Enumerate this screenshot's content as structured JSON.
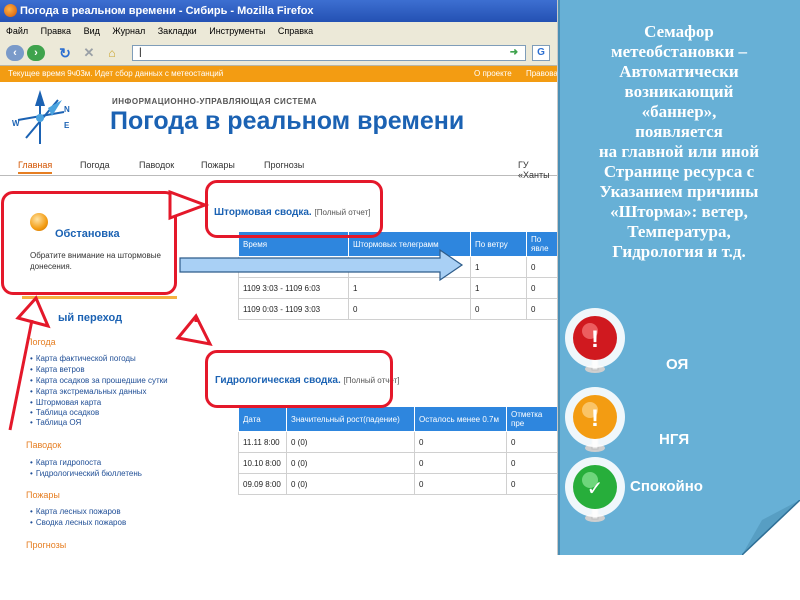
{
  "browser": {
    "window_title": "Погода в реальном времени - Сибирь - Mozilla Firefox",
    "menu": [
      {
        "label": "Файл"
      },
      {
        "label": "Правка"
      },
      {
        "label": "Вид"
      },
      {
        "label": "Журнал"
      },
      {
        "label": "Закладки"
      },
      {
        "label": "Инструменты"
      },
      {
        "label": "Справка"
      }
    ],
    "url_value": "|"
  },
  "site": {
    "status_text": "Текущее время 9ч03м. Идет сбор данных с метеостанций",
    "top_links": [
      "О проекте",
      "Правовая"
    ],
    "logo_subtitle": "ИНФОРМАЦИОННО-УПРАВЛЯЮЩАЯ СИСТЕМА",
    "logo_title": "Погода в реальном времени",
    "tabs": [
      "Главная",
      "Погода",
      "Паводок",
      "Пожары",
      "Прогнозы"
    ],
    "org": "ГУ «Ханты",
    "notice": {
      "title": "Обстановка",
      "text": "Обратите внимание на штормовые донесения."
    },
    "quick": {
      "title": "ый переход",
      "groups": [
        {
          "heading": "Погода",
          "links": [
            "Карта фактической погоды",
            "Карта ветров",
            "Карта осадков за прошедшие сутки",
            "Карта экстремальных данных",
            "Штормовая карта",
            "Таблица осадков",
            "Таблица ОЯ"
          ]
        },
        {
          "heading": "Паводок",
          "links": [
            "Карта гидропоста",
            "Гидрологический бюллетень"
          ]
        },
        {
          "heading": "Пожары",
          "links": [
            "Карта лесных пожаров",
            "Сводка лесных пожаров"
          ]
        },
        {
          "heading": "Прогнозы",
          "links": []
        }
      ]
    },
    "storm": {
      "title": "Штормовая сводка.",
      "full_report": "[Полный отчет]",
      "headers": [
        "Время",
        "Штормовых телеграмм",
        "По ветру",
        "По явле"
      ],
      "rows": [
        [
          "",
          "",
          "1",
          "0"
        ],
        [
          "1109 3:03 - 1109 6:03",
          "1",
          "1",
          "0"
        ],
        [
          "1109 0:03 - 1109 3:03",
          "0",
          "0",
          "0"
        ]
      ]
    },
    "hydro": {
      "title": "Гидрологическая сводка.",
      "full_report": "[Полный отчет]",
      "headers": [
        "Дата",
        "Значительный рост(падение)",
        "Осталось менее 0.7м",
        "Отметка пре"
      ],
      "rows": [
        [
          "11.11 8:00",
          "0 (0)",
          "0",
          "0"
        ],
        [
          "10.10 8:00",
          "0 (0)",
          "0",
          "0"
        ],
        [
          "09.09 8:00",
          "0 (0)",
          "0",
          "0"
        ]
      ]
    }
  },
  "panel": {
    "lines": [
      "Семафор",
      "метеобстановки –",
      "Автоматически",
      "возникающий",
      "«баннер»,",
      "появляется",
      "на главной или иной",
      "Странице ресурса с",
      "Указанием причины",
      "«Шторма»: ветер,",
      "Температура,",
      "Гидрология и т.д."
    ],
    "lights": [
      {
        "label": "ОЯ",
        "color": "#d0191f",
        "symbol": "!"
      },
      {
        "label": "НГЯ",
        "color": "#f39c12",
        "symbol": "!"
      },
      {
        "label": "Спокойно",
        "color": "#27ae3b",
        "symbol": "✓"
      }
    ]
  },
  "colors": {
    "accent": "#1b62b3",
    "highlight": "#e4182a",
    "panel": "#67b0d6"
  }
}
